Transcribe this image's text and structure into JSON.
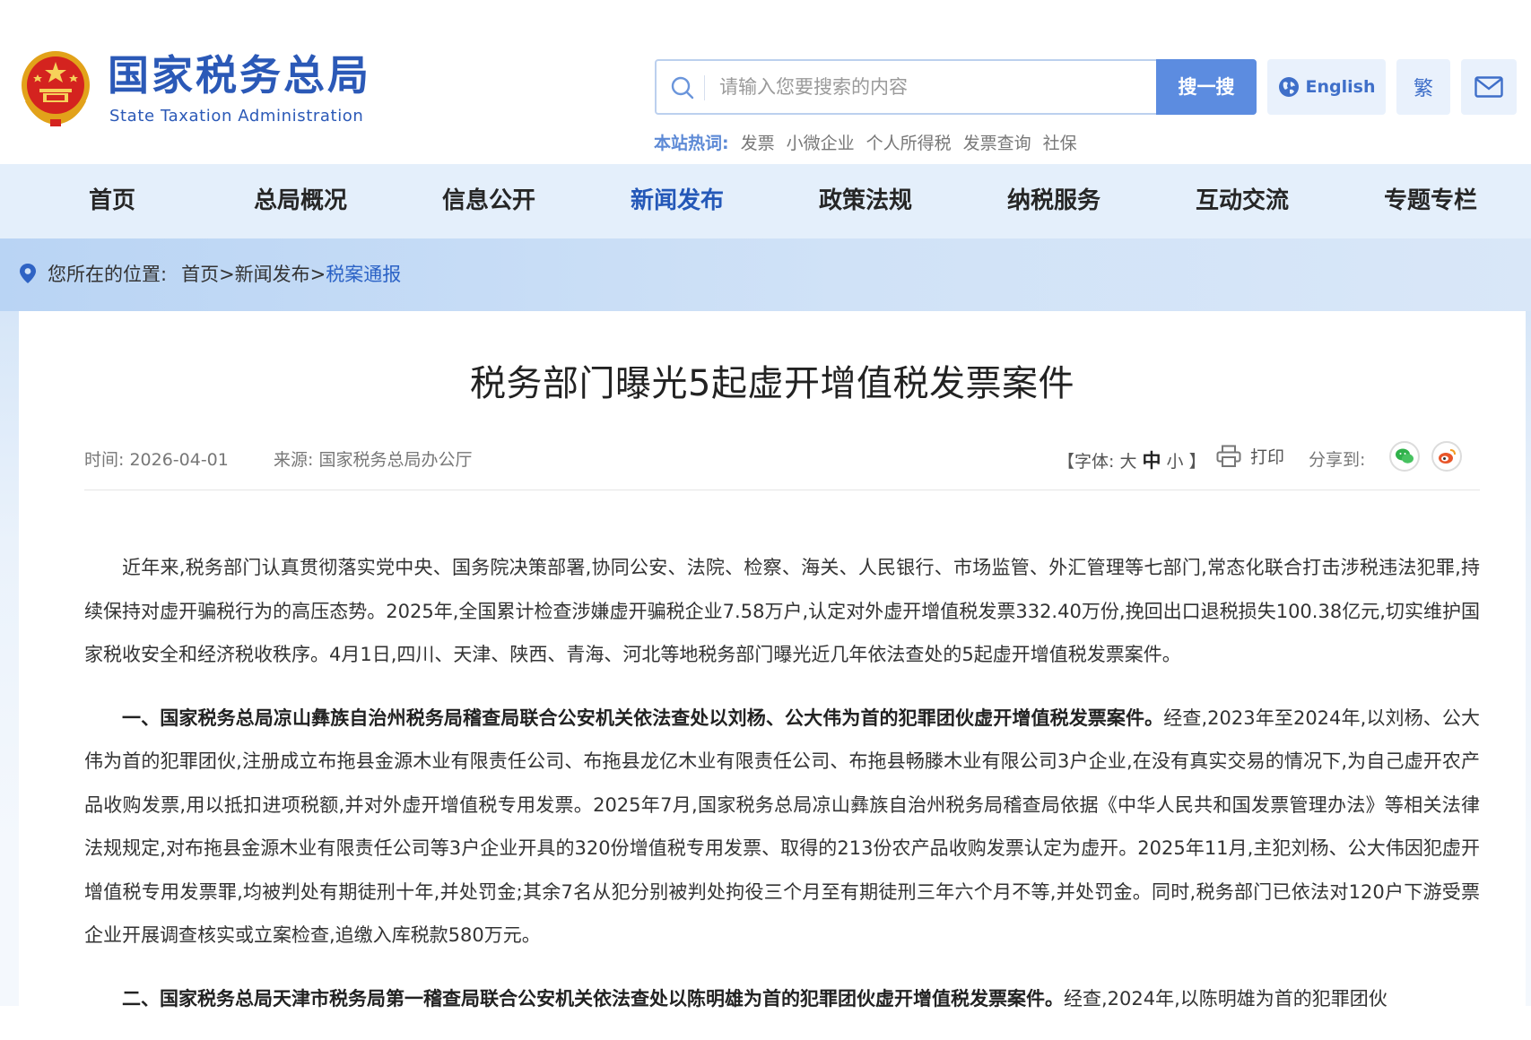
{
  "colors": {
    "brand_blue": "#2b59b7",
    "nav_bg": "#e4effb",
    "active_nav": "#2458b8",
    "search_button": "#5c8ce0"
  },
  "header": {
    "logo_cn": "国家税务总局",
    "logo_en": "State Taxation Administration",
    "emblem_icon": "national-emblem-icon"
  },
  "search": {
    "placeholder": "请输入您要搜索的内容",
    "button_label": "搜一搜",
    "english_label": "English",
    "traditional_label": "繁",
    "hot_label": "本站热词:",
    "hot_words": [
      "发票",
      "小微企业",
      "个人所得税",
      "发票查询",
      "社保"
    ]
  },
  "nav": {
    "items": [
      "首页",
      "总局概况",
      "信息公开",
      "新闻发布",
      "政策法规",
      "纳税服务",
      "互动交流",
      "专题专栏"
    ],
    "active": "新闻发布"
  },
  "breadcrumb": {
    "label": "您所在的位置:",
    "path": "首页>新闻发布>",
    "current": "税案通报"
  },
  "article": {
    "title": "税务部门曝光5起虚开增值税发票案件",
    "time": "时间: 2026-04-01",
    "source": "来源: 国家税务总局办公厅",
    "font_prefix": "【字体: 大 ",
    "font_mid": "中",
    "font_suffix": " 小 】",
    "print_label": "打印",
    "share_label": "分享到:",
    "p1": "近年来,税务部门认真贯彻落实党中央、国务院决策部署,协同公安、法院、检察、海关、人民银行、市场监管、外汇管理等七部门,常态化联合打击涉税违法犯罪,持续保持对虚开骗税行为的高压态势。2025年,全国累计检查涉嫌虚开骗税企业7.58万户,认定对外虚开增值税发票332.40万份,挽回出口退税损失100.38亿元,切实维护国家税收安全和经济税收秩序。4月1日,四川、天津、陕西、青海、河北等地税务部门曝光近几年依法查处的5起虚开增值税发票案件。",
    "p2_lead": "一、国家税务总局凉山彝族自治州税务局稽查局联合公安机关依法查处以刘杨、公大伟为首的犯罪团伙虚开增值税发票案件。",
    "p2_body": "经查,2023年至2024年,以刘杨、公大伟为首的犯罪团伙,注册成立布拖县金源木业有限责任公司、布拖县龙亿木业有限责任公司、布拖县畅滕木业有限公司3户企业,在没有真实交易的情况下,为自己虚开农产品收购发票,用以抵扣进项税额,并对外虚开增值税专用发票。2025年7月,国家税务总局凉山彝族自治州税务局稽查局依据《中华人民共和国发票管理办法》等相关法律法规规定,对布拖县金源木业有限责任公司等3户企业开具的320份增值税专用发票、取得的213份农产品收购发票认定为虚开。2025年11月,主犯刘杨、公大伟因犯虚开增值税专用发票罪,均被判处有期徒刑十年,并处罚金;其余7名从犯分别被判处拘役三个月至有期徒刑三年六个月不等,并处罚金。同时,税务部门已依法对120户下游受票企业开展调查核实或立案检查,追缴入库税款580万元。",
    "p3_lead": "二、国家税务总局天津市税务局第一稽查局联合公安机关依法查处以陈明雄为首的犯罪团伙虚开增值税发票案件。",
    "p3_body": "经查,2024年,以陈明雄为首的犯罪团伙"
  }
}
